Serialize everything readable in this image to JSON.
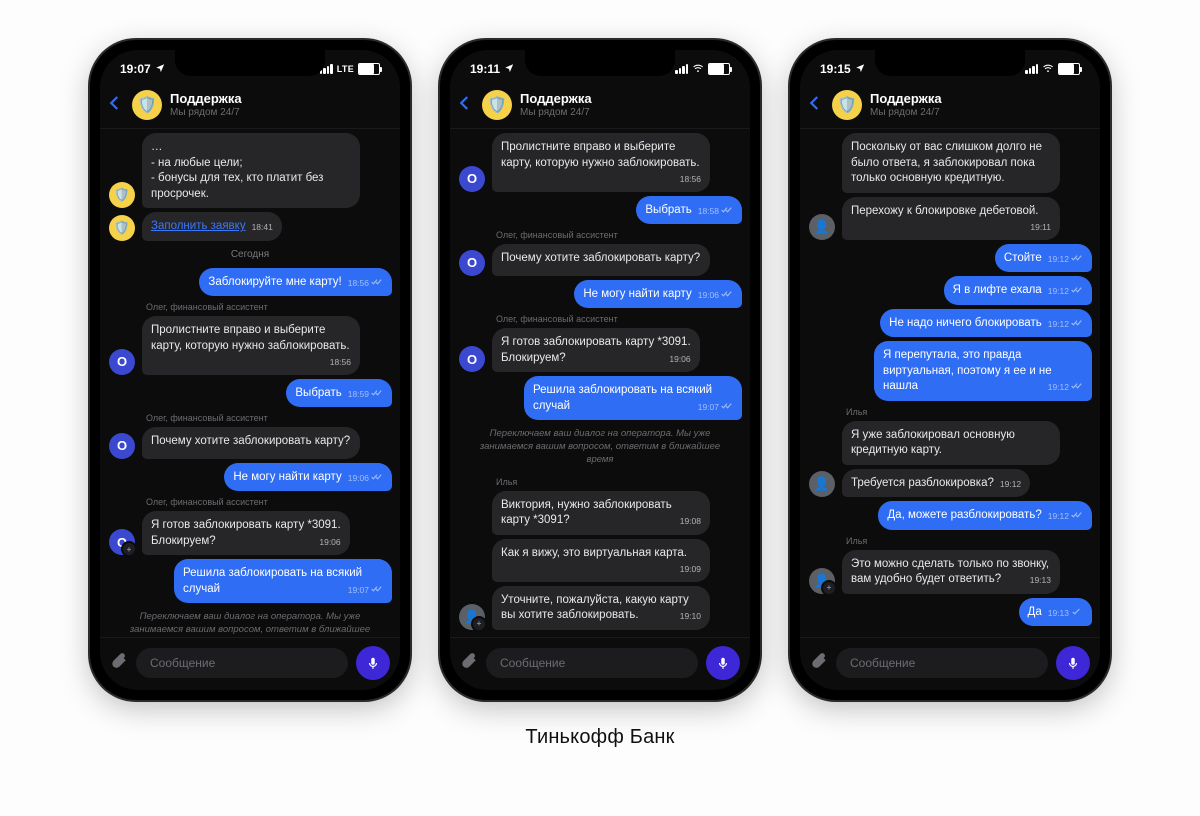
{
  "caption": "Тинькофф Банк",
  "composer_placeholder": "Сообщение",
  "header": {
    "title": "Поддержка",
    "subtitle": "Мы рядом 24/7"
  },
  "phones": [
    {
      "status_time": "19:07",
      "net_label": "LTE",
      "messages": [
        {
          "kind": "in",
          "avatar": "tinkoff",
          "text": "…\n- на любые цели;\n- бонусы для тех, кто платит без просрочек.",
          "time": ""
        },
        {
          "kind": "in",
          "avatar": "tinkoff",
          "link": "Заполнить заявку",
          "time": "18:41"
        },
        {
          "kind": "sep",
          "text": "Сегодня"
        },
        {
          "kind": "out",
          "text": "Заблокируйте мне карту!",
          "time": "18:56"
        },
        {
          "kind": "label",
          "text": "Олег, финансовый ассистент"
        },
        {
          "kind": "in",
          "avatar": "oleg",
          "text": "Пролистните вправо и выберите карту, которую нужно заблокировать.",
          "time": "18:56"
        },
        {
          "kind": "out",
          "text": "Выбрать",
          "time": "18:59"
        },
        {
          "kind": "label",
          "text": "Олег, финансовый ассистент"
        },
        {
          "kind": "in",
          "avatar": "oleg",
          "text": "Почему хотите заблокировать карту?",
          "time": ""
        },
        {
          "kind": "out",
          "text": "Не могу найти карту",
          "time": "19:06"
        },
        {
          "kind": "label",
          "text": "Олег, финансовый ассистент"
        },
        {
          "kind": "in",
          "avatar": "oleg",
          "badge": true,
          "text": "Я готов заблокировать карту *3091.\nБлокируем?",
          "time": "19:06"
        },
        {
          "kind": "out",
          "text": "Решила заблокировать на всякий случай",
          "time": "19:07"
        },
        {
          "kind": "system",
          "text": "Переключаем ваш диалог на оператора. Мы уже занимаемся вашим вопросом, ответим в ближайшее время"
        }
      ]
    },
    {
      "status_time": "19:11",
      "net_label": "wifi",
      "messages": [
        {
          "kind": "in",
          "avatar": "oleg",
          "text": "Пролистните вправо и выберите карту, которую нужно заблокировать.",
          "time": "18:56"
        },
        {
          "kind": "out",
          "text": "Выбрать",
          "time": "18:58"
        },
        {
          "kind": "label",
          "text": "Олег, финансовый ассистент"
        },
        {
          "kind": "in",
          "avatar": "oleg",
          "text": "Почему хотите заблокировать карту?",
          "time": ""
        },
        {
          "kind": "out",
          "text": "Не могу найти карту",
          "time": "19:06"
        },
        {
          "kind": "label",
          "text": "Олег, финансовый ассистент"
        },
        {
          "kind": "in",
          "avatar": "oleg",
          "text": "Я готов заблокировать карту *3091.\nБлокируем?",
          "time": "19:06"
        },
        {
          "kind": "out",
          "text": "Решила заблокировать на всякий случай",
          "time": "19:07"
        },
        {
          "kind": "system",
          "text": "Переключаем ваш диалог на оператора. Мы уже занимаемся вашим вопросом, ответим в ближайшее время"
        },
        {
          "kind": "label",
          "text": "Илья"
        },
        {
          "kind": "in",
          "avatar": "none",
          "text": "Виктория, нужно заблокировать карту *3091?",
          "time": "19:08"
        },
        {
          "kind": "in",
          "avatar": "none",
          "text": "Как я вижу, это виртуальная карта.",
          "time": "19:09"
        },
        {
          "kind": "in",
          "avatar": "human",
          "badge": true,
          "text": "Уточните, пожалуйста, какую карту вы хотите заблокировать.",
          "time": "19:10"
        }
      ]
    },
    {
      "status_time": "19:15",
      "net_label": "wifi",
      "messages": [
        {
          "kind": "in",
          "avatar": "none",
          "text": "Поскольку от вас слишком долго не было ответа, я заблокировал пока только основную кредитную.",
          "time": ""
        },
        {
          "kind": "in",
          "avatar": "human",
          "text": "Перехожу к блокировке дебетовой.",
          "time": "19:11"
        },
        {
          "kind": "out",
          "text": "Стойте",
          "time": "19:12"
        },
        {
          "kind": "out",
          "text": "Я в лифте ехала",
          "time": "19:12"
        },
        {
          "kind": "out",
          "text": "Не надо ничего блокировать",
          "time": "19:12"
        },
        {
          "kind": "out",
          "text": "Я перепутала, это правда виртуальная, поэтому я ее и не нашла",
          "time": "19:12"
        },
        {
          "kind": "label",
          "text": "Илья"
        },
        {
          "kind": "in",
          "avatar": "none",
          "text": "Я уже заблокировал основную кредитную карту.",
          "time": ""
        },
        {
          "kind": "in",
          "avatar": "human",
          "text": "Требуется разблокировка?",
          "time": "19:12"
        },
        {
          "kind": "out",
          "text": "Да, можете разблокировать?",
          "time": "19:12"
        },
        {
          "kind": "label",
          "text": "Илья"
        },
        {
          "kind": "in",
          "avatar": "human",
          "badge": true,
          "text": "Это можно сделать только по звонку, вам удобно будет ответить?",
          "time": "19:13"
        },
        {
          "kind": "out",
          "text": "Да",
          "time": "19:13",
          "single_check": true
        }
      ]
    }
  ]
}
